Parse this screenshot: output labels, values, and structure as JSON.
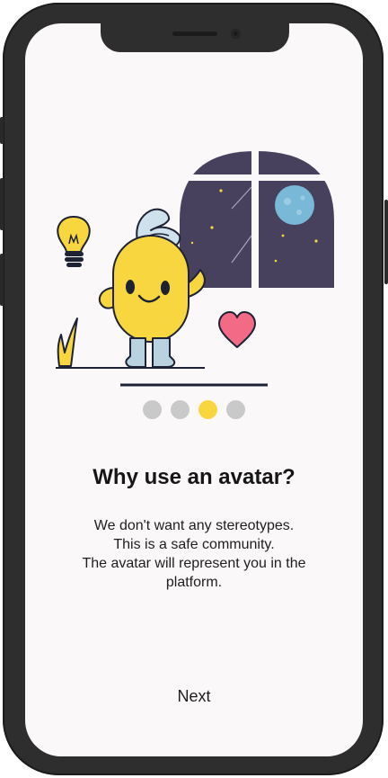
{
  "onboarding": {
    "title": "Why use an avatar?",
    "description_lines": [
      "We don't want any stereotypes.",
      "This is a safe community.",
      "The avatar will represent you in the",
      "platform."
    ],
    "next_label": "Next",
    "pagination": {
      "total": 4,
      "active_index": 2
    }
  },
  "colors": {
    "screen_bg": "#fbf8fa",
    "frame": "#2e2e2e",
    "dot_inactive": "#c9c9c9",
    "dot_active": "#f8d63f",
    "mascot_yellow": "#f8d63f",
    "window_night": "#48415e",
    "moon": "#7ab8d8",
    "heart": "#f36a86"
  },
  "icons": [
    "lightbulb-icon",
    "mascot-avatar",
    "night-window",
    "moon-icon",
    "heart-icon",
    "grass-icon"
  ]
}
